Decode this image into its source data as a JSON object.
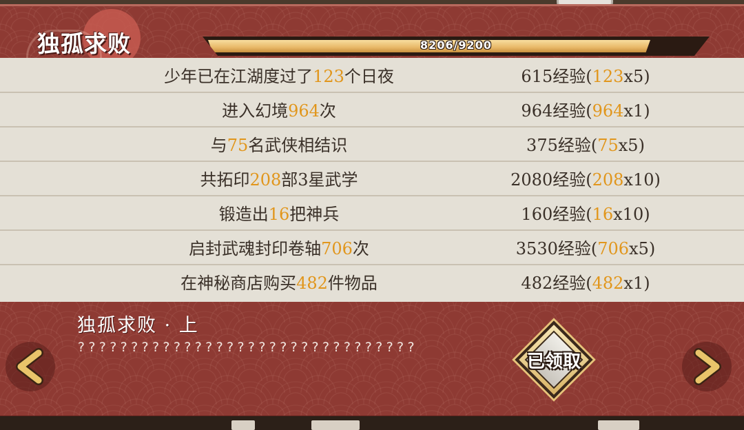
{
  "header": {
    "title": "独孤求败",
    "progress_text": "8206/9200",
    "progress_fraction": 0.892
  },
  "achievements": [
    {
      "desc_pre": "少年已在江湖度过了",
      "desc_num": "123",
      "desc_post": "个日夜",
      "exp_pre": "615经验(",
      "exp_num": "123",
      "exp_post": "x5)"
    },
    {
      "desc_pre": "进入幻境",
      "desc_num": "964",
      "desc_post": "次",
      "exp_pre": "964经验(",
      "exp_num": "964",
      "exp_post": "x1)"
    },
    {
      "desc_pre": "与",
      "desc_num": "75",
      "desc_post": "名武侠相结识",
      "exp_pre": "375经验(",
      "exp_num": "75",
      "exp_post": "x5)"
    },
    {
      "desc_pre": "共拓印",
      "desc_num": "208",
      "desc_post": "部3星武学",
      "exp_pre": "2080经验(",
      "exp_num": "208",
      "exp_post": "x10)"
    },
    {
      "desc_pre": "锻造出",
      "desc_num": "16",
      "desc_post": "把神兵",
      "exp_pre": "160经验(",
      "exp_num": "16",
      "exp_post": "x10)"
    },
    {
      "desc_pre": "启封武魂封印卷轴",
      "desc_num": "706",
      "desc_post": "次",
      "exp_pre": "3530经验(",
      "exp_num": "706",
      "exp_post": "x5)"
    },
    {
      "desc_pre": "在神秘商店购买",
      "desc_num": "482",
      "desc_post": "件物品",
      "exp_pre": "482经验(",
      "exp_num": "482",
      "exp_post": "x1)"
    }
  ],
  "quest": {
    "title": "独孤求败 · 上",
    "description": "????????????????????????????????"
  },
  "badge": {
    "label": "已领取"
  },
  "colors": {
    "panel": "#8e3a33",
    "list_bg": "#e4e0d6",
    "highlight": "#e1961c",
    "progress": "#e8b868"
  },
  "icons": {
    "left": "chevron-left-icon",
    "right": "chevron-right-icon"
  }
}
